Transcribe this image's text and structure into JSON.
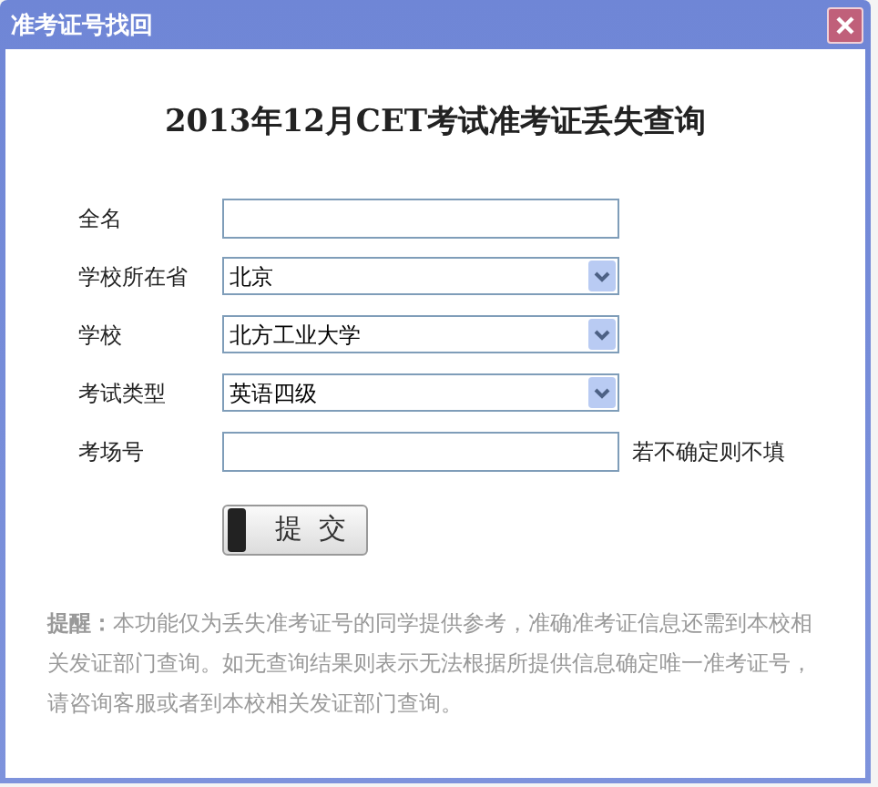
{
  "window": {
    "title": "准考证号找回"
  },
  "heading": "2013年12月CET考试准考证丢失查询",
  "fields": [
    {
      "kind": "text",
      "label": "全名"
    },
    {
      "kind": "select",
      "label": "学校所在省",
      "value": "北京"
    },
    {
      "kind": "select",
      "label": "学校",
      "value": "北方工业大学"
    },
    {
      "kind": "select",
      "label": "考试类型",
      "value": "英语四级"
    },
    {
      "kind": "text",
      "label": "考场号",
      "hint": "若不确定则不填"
    }
  ],
  "submit": "提 交",
  "note": "**提醒：**本功能仅为丢失准考证号的同学提供参考，准确准考证信息还需到本校相关发证部门查询。如无查询结果则表示无法根据所提供信息确定唯一准考证号，请咨询客服或者到本校相关发证部门查询。"
}
